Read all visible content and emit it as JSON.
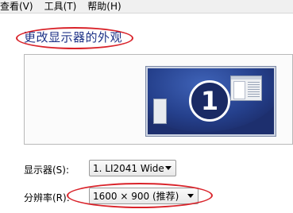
{
  "menubar": {
    "items": [
      "查看(V)",
      "工具(T)",
      "帮助(H)"
    ]
  },
  "page": {
    "title": "更改显示器的外观"
  },
  "preview": {
    "monitor_number": "1"
  },
  "settings": {
    "display_label": "显示器(S):",
    "display_value": "1. LI2041 Wide",
    "resolution_label": "分辨率(R):",
    "resolution_value": "1600 × 900 (推荐)"
  },
  "colors": {
    "annotation_ring": "#d9232a",
    "title": "#1e3287",
    "monitor_bg": "#1d2f6e"
  }
}
